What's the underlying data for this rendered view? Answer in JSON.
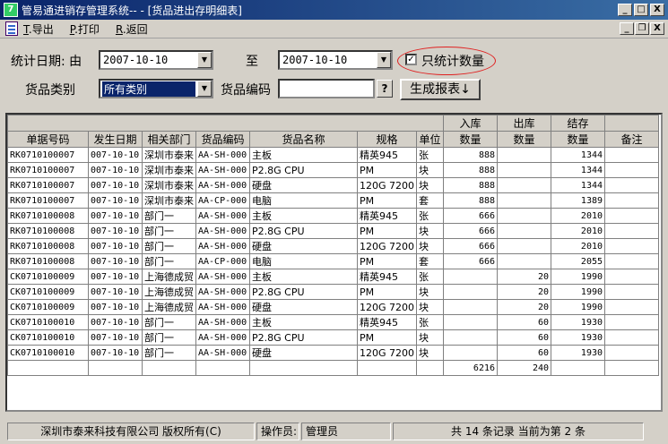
{
  "window": {
    "title": "管易通进销存管理系统-- - [货品进出存明细表]",
    "minimize": "_",
    "maximize": "□",
    "close": "X",
    "child_minimize": "_",
    "child_restore": "❐",
    "child_close": "X"
  },
  "menu": {
    "export_key": "T",
    "export": ".导出",
    "print_key": "P",
    "print": ".打印",
    "back_key": "R",
    "back": ".返回"
  },
  "filters": {
    "date_label": "统计日期: 由",
    "from_date": "2007-10-10",
    "to_label": "至",
    "to_date": "2007-10-10",
    "only_qty_label": "只统计数量",
    "only_qty_checked": "✓",
    "category_label": "货品类别",
    "category_value": "所有类别",
    "code_label": "货品编码",
    "code_value": "",
    "lookup_button": "?",
    "generate_button": "生成报表↓"
  },
  "table": {
    "group_headers": {
      "in": "入库",
      "out": "出库",
      "stock": "结存"
    },
    "columns": [
      "单据号码",
      "发生日期",
      "相关部门",
      "货品编码",
      "货品名称",
      "规格",
      "单位",
      "数量",
      "数量",
      "数量",
      "备注"
    ],
    "rows": [
      [
        "RK0710100007",
        "007-10-10",
        "深圳市泰来",
        "AA-SH-000",
        "主板",
        "精英945",
        "张",
        "888",
        "",
        "1344",
        ""
      ],
      [
        "RK0710100007",
        "007-10-10",
        "深圳市泰来",
        "AA-SH-000",
        "P2.8G CPU",
        "PM",
        "块",
        "888",
        "",
        "1344",
        ""
      ],
      [
        "RK0710100007",
        "007-10-10",
        "深圳市泰来",
        "AA-SH-000",
        "硬盘",
        "120G 7200",
        "块",
        "888",
        "",
        "1344",
        ""
      ],
      [
        "RK0710100007",
        "007-10-10",
        "深圳市泰来",
        "AA-CP-000",
        "电脑",
        "PM",
        "套",
        "888",
        "",
        "1389",
        ""
      ],
      [
        "RK0710100008",
        "007-10-10",
        "部门一",
        "AA-SH-000",
        "主板",
        "精英945",
        "张",
        "666",
        "",
        "2010",
        ""
      ],
      [
        "RK0710100008",
        "007-10-10",
        "部门一",
        "AA-SH-000",
        "P2.8G CPU",
        "PM",
        "块",
        "666",
        "",
        "2010",
        ""
      ],
      [
        "RK0710100008",
        "007-10-10",
        "部门一",
        "AA-SH-000",
        "硬盘",
        "120G 7200",
        "块",
        "666",
        "",
        "2010",
        ""
      ],
      [
        "RK0710100008",
        "007-10-10",
        "部门一",
        "AA-CP-000",
        "电脑",
        "PM",
        "套",
        "666",
        "",
        "2055",
        ""
      ],
      [
        "CK0710100009",
        "007-10-10",
        "上海德成贸",
        "AA-SH-000",
        "主板",
        "精英945",
        "张",
        "",
        "20",
        "1990",
        ""
      ],
      [
        "CK0710100009",
        "007-10-10",
        "上海德成贸",
        "AA-SH-000",
        "P2.8G CPU",
        "PM",
        "块",
        "",
        "20",
        "1990",
        ""
      ],
      [
        "CK0710100009",
        "007-10-10",
        "上海德成贸",
        "AA-SH-000",
        "硬盘",
        "120G 7200",
        "块",
        "",
        "20",
        "1990",
        ""
      ],
      [
        "CK0710100010",
        "007-10-10",
        "部门一",
        "AA-SH-000",
        "主板",
        "精英945",
        "张",
        "",
        "60",
        "1930",
        ""
      ],
      [
        "CK0710100010",
        "007-10-10",
        "部门一",
        "AA-SH-000",
        "P2.8G CPU",
        "PM",
        "块",
        "",
        "60",
        "1930",
        ""
      ],
      [
        "CK0710100010",
        "007-10-10",
        "部门一",
        "AA-SH-000",
        "硬盘",
        "120G 7200",
        "块",
        "",
        "60",
        "1930",
        ""
      ]
    ],
    "totals": [
      "",
      "",
      "",
      "",
      "",
      "",
      "",
      "6216",
      "240",
      "",
      ""
    ]
  },
  "status": {
    "company": "深圳市泰来科技有限公司 版权所有(C)",
    "operator_label": "操作员:",
    "operator": "管理员",
    "records": "共 14 条记录 当前为第 2 条"
  }
}
